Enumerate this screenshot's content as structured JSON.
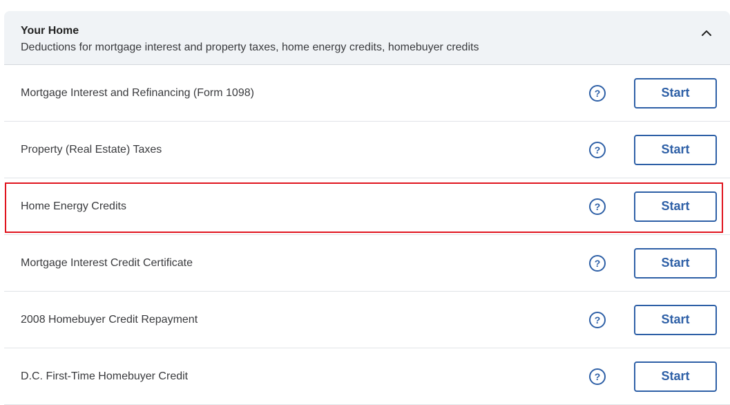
{
  "section": {
    "title": "Your Home",
    "subtitle": "Deductions for mortgage interest and property taxes, home energy credits, homebuyer credits",
    "collapse_icon": "chevron-up-icon"
  },
  "rows": [
    {
      "label": "Mortgage Interest and Refinancing (Form 1098)",
      "button": "Start",
      "help_icon": "question-circle-icon"
    },
    {
      "label": "Property (Real Estate) Taxes",
      "button": "Start",
      "help_icon": "question-circle-icon"
    },
    {
      "label": "Home Energy Credits",
      "button": "Start",
      "help_icon": "question-circle-icon",
      "highlighted": true
    },
    {
      "label": "Mortgage Interest Credit Certificate",
      "button": "Start",
      "help_icon": "question-circle-icon"
    },
    {
      "label": "2008 Homebuyer Credit Repayment",
      "button": "Start",
      "help_icon": "question-circle-icon"
    },
    {
      "label": "D.C. First-Time Homebuyer Credit",
      "button": "Start",
      "help_icon": "question-circle-icon"
    }
  ],
  "colors": {
    "accent": "#2d5fa6",
    "header_bg": "#f0f3f6",
    "highlight": "#e0141e"
  }
}
